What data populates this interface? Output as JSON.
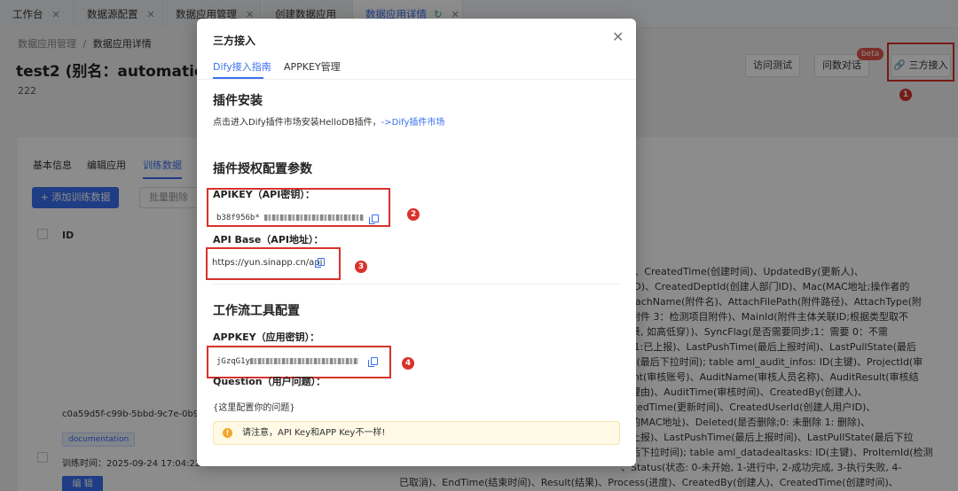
{
  "tabs": [
    {
      "label": "工作台"
    },
    {
      "label": "数据源配置"
    },
    {
      "label": "数据应用管理"
    },
    {
      "label": "创建数据应用"
    },
    {
      "label": "数据应用详情"
    }
  ],
  "breadcrumb": {
    "parent": "数据应用管理",
    "separator": "/",
    "current": "数据应用详情"
  },
  "page": {
    "title": "test2 (别名：automatic_lab2)",
    "description": "222"
  },
  "actions": {
    "access_test": "访问测试",
    "data_chat": "问数对话",
    "beta_badge": "beta",
    "third_party": "三方接入"
  },
  "sub_tabs": [
    {
      "label": "基本信息"
    },
    {
      "label": "编辑应用"
    },
    {
      "label": "训练数据"
    }
  ],
  "toolbar": {
    "add_training": "+ 添加训练数据",
    "batch_delete": "批量删除"
  },
  "table": {
    "col_id": "ID",
    "row_id": "c0a59d5f-c99b-5bbd-9c7e-0b9",
    "tag": "documentation",
    "train_time": "训练时间：2025-09-24 17:04:22",
    "edit": "编 辑",
    "content_lines": [
      "人)、CreatedTime(创建时间)、UpdatedBy(更新人)、",
      "户ID)、CreatedDeptId(创建人部门ID)、Mac(MAC地址;操作者的",
      "AttachName(附件名)、AttachFilePath(附件路径)、AttachType(附",
      "据附件 3：检测项目附件)、MainId(附件主体关联ID;根据类型取不",
      "场景, 如高低穿）)、SyncFlag(是否需要同步;1：需要 0：不需",
      "中 1:已上报)、LastPushTime(最后上报时间)、LastPullState(最后",
      "me(最后下拉时间); table aml_audit_infos: ID(主键)、ProjectId(审",
      "ount(审核账号)、AuditName(审核人员名称)、AuditResult(审核结",
      "回理由)、AuditTime(审核时间)、CreatedBy(创建人)、",
      "datedTime(更新时间)、CreatedUserId(创建人用户ID)、",
      "者的MAC地址)、Deleted(是否删除;0: 未删除 1: 删除)、",
      "已上报)、LastPushTime(最后上报时间)、LastPullState(最后下拉",
      "最后下拉时间); table aml_datadealtasks: ID(主键)、ProItemId(检测",
      "、Status(状态: 0-未开始, 1-进行中, 2-成功完成, 3-执行失败, 4-",
      "已取消)、EndTime(结束时间)、Result(结果)、Process(进度)、CreatedBy(创建人)、CreatedTime(创建时间)、"
    ]
  },
  "annotations": [
    "1",
    "2",
    "3",
    "4"
  ],
  "modal": {
    "title": "三方接入",
    "close_icon": "close-icon",
    "tabs": [
      {
        "label": "Dify接入指南"
      },
      {
        "label": "APPKEY管理"
      }
    ],
    "plugin_install": {
      "heading": "插件安装",
      "text": "点击进入Dify插件市场安装HelloDB插件，",
      "link": "->Dify插件市场"
    },
    "auth": {
      "heading": "插件授权配置参数",
      "apikey_label": "APIKEY（API密钥）：",
      "apikey_prefix": "b38f956b*",
      "apibase_label": "API Base（API地址）：",
      "apibase_value": "https://yun.sinapp.cn/api"
    },
    "workflow": {
      "heading": "工作流工具配置",
      "appkey_label": "APPKEY（应用密钥）：",
      "appkey_prefix": "jGzqG1y",
      "question_label": "Question（用户问题）：",
      "question_value": "{这里配置你的问题}"
    },
    "notice": "请注意，API Key和APP Key不一样!"
  },
  "colors": {
    "accent": "#3a6ff0",
    "highlight": "#d8322b",
    "warning": "#f4a62a"
  }
}
